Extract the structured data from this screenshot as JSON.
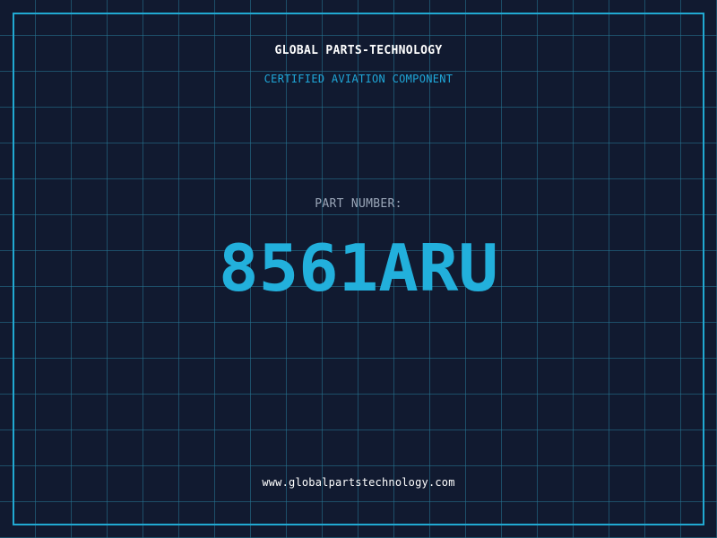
{
  "header": {
    "company_name": "GLOBAL PARTS-TECHNOLOGY",
    "tagline": "CERTIFIED AVIATION COMPONENT"
  },
  "part": {
    "label": "PART NUMBER:",
    "number": "8561ARU"
  },
  "footer": {
    "website": "www.globalpartstechnology.com"
  },
  "colors": {
    "background": "#111a30",
    "grid": "#26789a",
    "frame": "#21a9d2",
    "accent": "#1fa7d8",
    "part_number": "#22b0dc"
  }
}
